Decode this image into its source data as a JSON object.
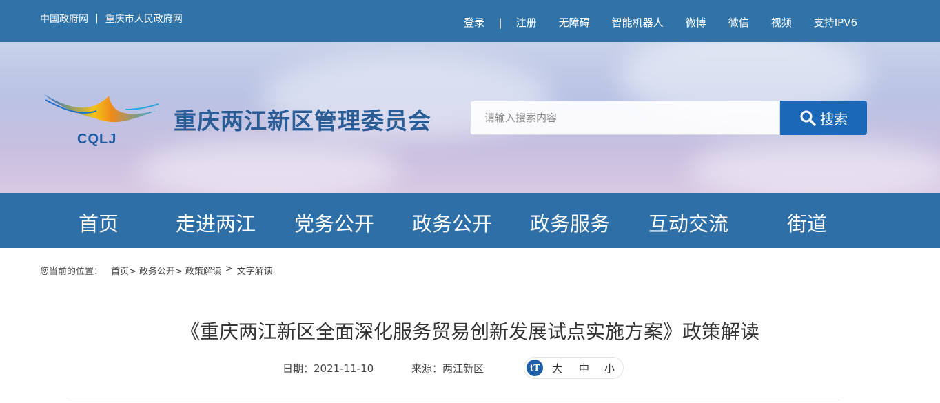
{
  "topbar": {
    "left_links": [
      "中国政府网",
      "重庆市人民政府网"
    ],
    "separator": "|",
    "login": "登录",
    "pipe": "|",
    "register": "注册",
    "right_links": [
      "无障碍",
      "智能机器人",
      "微博",
      "微信",
      "视频",
      "支持IPV6"
    ]
  },
  "header": {
    "logo_text": "CQLJ",
    "site_title": "重庆两江新区管理委员会",
    "search_placeholder": "请输入搜索内容",
    "search_button": "搜索"
  },
  "nav": {
    "items": [
      "首页",
      "走进两江",
      "党务公开",
      "政务公开",
      "政务服务",
      "互动交流",
      "街道"
    ]
  },
  "breadcrumb": {
    "prefix": "您当前的位置：",
    "items": [
      "首页>",
      "政务公开>",
      "政策解读",
      ">",
      "文字解读"
    ]
  },
  "article": {
    "title": "《重庆两江新区全面深化服务贸易创新发展试点实施方案》政策解读",
    "date_label": "日期：",
    "date": "2021-11-10",
    "source_label": "来源：",
    "source": "两江新区",
    "font_icon": "tT",
    "font_large": "大",
    "font_medium": "中",
    "font_small": "小"
  },
  "colors": {
    "topbar": "#2f73a9",
    "nav": "#2f6fa7",
    "search_button": "#1b67b8",
    "title": "#2a5d96"
  }
}
